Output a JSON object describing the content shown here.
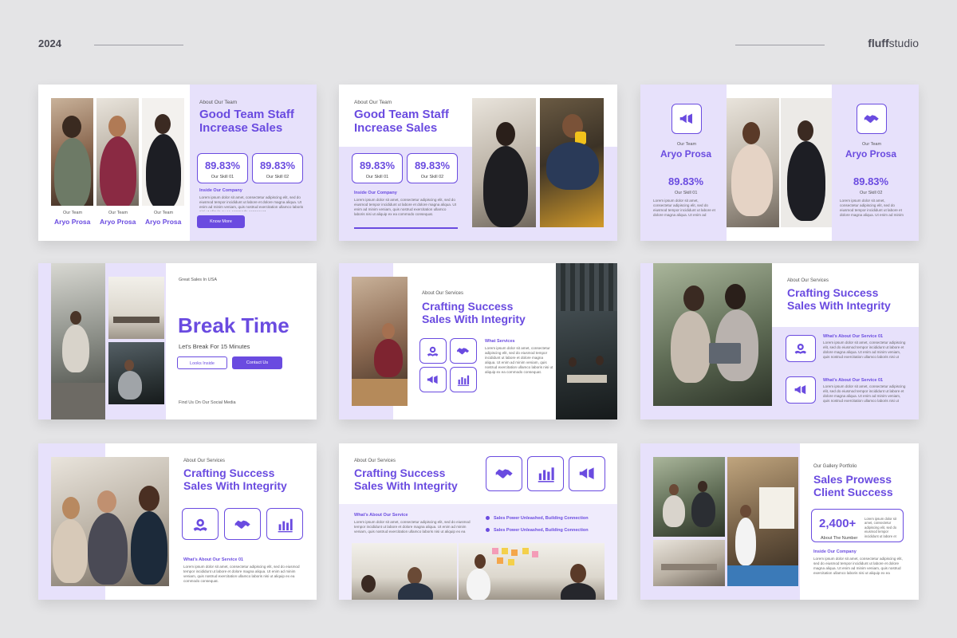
{
  "header": {
    "year": "2024",
    "brand_a": "fluff",
    "brand_b": "studio"
  },
  "colors": {
    "accent": "#6a4be0",
    "lavender": "#e7e1fb",
    "background": "#e4e4e6"
  },
  "lorem": "Lorem ipsum dolor sit amet, consectetur adipiscing elit, sed do eiusmod tempor incididunt ut labore et dolore magna aliqua. Ut enim ad minim veniam, quis nostrud exercitation ullamco laboris nisi ut aliquip ex ea commodo consequat.",
  "slide1": {
    "eyebrow": "About Our Team",
    "title_l1": "Good Team Staff",
    "title_l2": "Increase Sales",
    "stat1_value": "89.83%",
    "stat1_label": "Our Skill 01",
    "stat2_value": "89.83%",
    "stat2_label": "Our Skill 02",
    "sub": "Inside Our Company",
    "button": "Know More",
    "members": [
      {
        "role": "Our Team",
        "name": "Aryo Prosa"
      },
      {
        "role": "Our Team",
        "name": "Aryo Prosa"
      },
      {
        "role": "Our Team",
        "name": "Aryo Prosa"
      }
    ]
  },
  "slide2": {
    "eyebrow": "About Our Team",
    "title_l1": "Good Team Staff",
    "title_l2": "Increase Sales",
    "stat1_value": "89.83%",
    "stat1_label": "Our Skill 01",
    "stat2_value": "89.83%",
    "stat2_label": "Our Skill 02",
    "sub": "Inside Our Company"
  },
  "slide3": {
    "left": {
      "role": "Our Team",
      "name": "Aryo Prosa",
      "value": "89.83%",
      "label": "Our Skill 01",
      "icon": "megaphone-icon"
    },
    "right": {
      "role": "Our Team",
      "name": "Aryo Prosa",
      "value": "89.83%",
      "label": "Our Skill 02",
      "icon": "handshake-icon"
    }
  },
  "slide4": {
    "eyebrow": "Great Sales In USA",
    "title": "Break Time",
    "subtitle": "Let's Break For 15 Minutes",
    "btn1": "Looks Inside",
    "btn2": "Contact Us",
    "footer": "Find Us On Our Social Media"
  },
  "slide5": {
    "eyebrow": "About Our Services",
    "title_l1": "Crafting Success",
    "title_l2": "Sales With Integrity",
    "sub": "What Services",
    "icons": [
      "award-icon",
      "handshake-icon",
      "megaphone-icon",
      "chart-icon"
    ]
  },
  "slide6": {
    "eyebrow": "About Our Services",
    "title_l1": "Crafting Success",
    "title_l2": "Sales With Integrity",
    "item1": "What's About Our Service 01",
    "item2": "What's About Our Service 01",
    "icons": [
      "award-icon",
      "megaphone-icon"
    ]
  },
  "slide7": {
    "eyebrow": "About Our Services",
    "title_l1": "Crafting Success",
    "title_l2": "Sales With Integrity",
    "sub": "What's About Our Service 01",
    "icons": [
      "award-icon",
      "handshake-icon",
      "chart-icon"
    ]
  },
  "slide8": {
    "eyebrow": "About Our Services",
    "title_l1": "Crafting Success",
    "title_l2": "Sales With Integrity",
    "sub": "What's About Our Service",
    "bullet1": "Sales Power Unleashed, Building Connection",
    "bullet2": "Sales Power Unleashed, Building Connection",
    "icons": [
      "handshake-icon",
      "chart-icon",
      "megaphone-icon"
    ]
  },
  "slide9": {
    "eyebrow": "Our Gallery Portfolio",
    "title_l1": "Sales Prowess",
    "title_l2": "Client Success",
    "stat_value": "2,400+",
    "stat_label": "About The Number",
    "sub": "Inside Our Company"
  }
}
